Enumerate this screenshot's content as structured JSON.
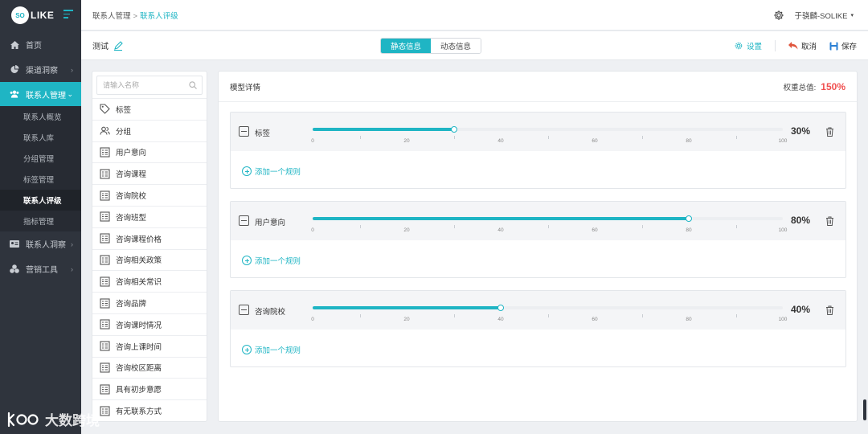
{
  "brand": {
    "logo_badge": "SO",
    "logo_text": "LIKE",
    "accent": "#1fb5c4",
    "sidebar_bg": "#2f343d"
  },
  "sidebar": {
    "items": [
      {
        "label": "首页",
        "icon": "home-icon"
      },
      {
        "label": "渠道洞察",
        "icon": "pie-chart-icon"
      },
      {
        "label": "联系人管理",
        "icon": "users-icon"
      },
      {
        "label": "联系人洞察",
        "icon": "id-card-icon"
      },
      {
        "label": "营销工具",
        "icon": "tools-icon"
      }
    ],
    "subitems": [
      "联系人概览",
      "联系人库",
      "分组管理",
      "标签管理",
      "联系人评级",
      "指标管理"
    ]
  },
  "breadcrumb": {
    "parent": "联系人管理",
    "separator": ">",
    "current": "联系人评级"
  },
  "user": {
    "name": "于骁麟-SOLIKE"
  },
  "toolbar": {
    "title": "测试",
    "tab_static": "静态信息",
    "tab_dynamic": "动态信息",
    "settings_label": "设置",
    "cancel_label": "取消",
    "save_label": "保存"
  },
  "left_panel": {
    "search_placeholder": "请输入名称",
    "items": [
      {
        "label": "标签",
        "icon": "tag-icon"
      },
      {
        "label": "分组",
        "icon": "group-icon"
      },
      {
        "label": "用户意向",
        "icon": "form-icon"
      },
      {
        "label": "咨询课程",
        "icon": "form-icon"
      },
      {
        "label": "咨询院校",
        "icon": "form-icon"
      },
      {
        "label": "咨询班型",
        "icon": "form-icon"
      },
      {
        "label": "咨询课程价格",
        "icon": "form-icon"
      },
      {
        "label": "咨询相关政策",
        "icon": "form-icon"
      },
      {
        "label": "咨询相关常识",
        "icon": "form-icon"
      },
      {
        "label": "咨询品牌",
        "icon": "form-icon"
      },
      {
        "label": "咨询课时情况",
        "icon": "form-icon"
      },
      {
        "label": "咨询上课时间",
        "icon": "form-icon"
      },
      {
        "label": "咨询校区距离",
        "icon": "form-icon"
      },
      {
        "label": "具有初步意愿",
        "icon": "form-icon"
      },
      {
        "label": "有无联系方式",
        "icon": "form-icon"
      }
    ]
  },
  "main_panel": {
    "title": "模型详情",
    "total_label": "权重总值:",
    "total_value": "150%",
    "total_color": "#f05050",
    "slider_ticks": [
      "0",
      "20",
      "40",
      "60",
      "80",
      "100"
    ],
    "add_rule_label": "添加一个规则",
    "rules": [
      {
        "name": "标签",
        "weight": 30,
        "weight_label": "30%"
      },
      {
        "name": "用户意向",
        "weight": 80,
        "weight_label": "80%"
      },
      {
        "name": "咨询院校",
        "weight": 40,
        "weight_label": "40%"
      }
    ]
  },
  "watermark": {
    "text": "大数跨境"
  }
}
